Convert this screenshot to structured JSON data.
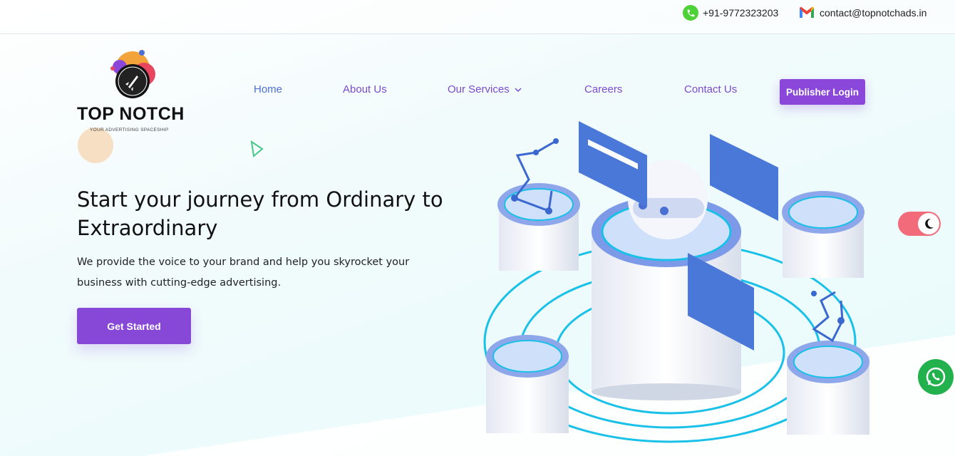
{
  "topbar": {
    "phone": "+91-9772323203",
    "email": "contact@topnotchads.in",
    "phone_icon": "phone-icon",
    "email_icon": "gmail-icon"
  },
  "logo": {
    "title": "TOP NOTCH",
    "tagline": "YOUR ADVERTISING SPACESHIP",
    "icon": "rocket-icon"
  },
  "nav": {
    "items": [
      {
        "label": "Home"
      },
      {
        "label": "About Us"
      },
      {
        "label": "Our Services"
      },
      {
        "label": "Careers"
      },
      {
        "label": "Contact Us"
      }
    ],
    "publisher_login": "Publisher Login"
  },
  "hero": {
    "title": "Start your journey from Ordinary to Extraordinary",
    "subtitle": "We provide the voice to your brand and help you skyrocket your business with cutting-edge advertising.",
    "cta": "Get Started"
  },
  "widgets": {
    "theme_toggle_icon": "moon-icon",
    "whatsapp_icon": "whatsapp-icon"
  },
  "colors": {
    "accent": "#8747d7",
    "nav_text": "#7a4bd0",
    "nav_active": "#4d6fd6",
    "toggle": "#f26b7a",
    "whatsapp": "#22b14c"
  }
}
